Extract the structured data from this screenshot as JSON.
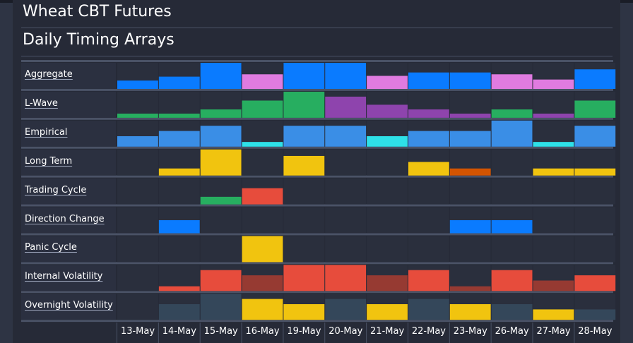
{
  "header": {
    "title": "Wheat CBT Futures",
    "subtitle": "Daily Timing Arrays"
  },
  "chart_data": {
    "type": "heatmap",
    "categories": [
      "13-May",
      "14-May",
      "15-May",
      "16-May",
      "19-May",
      "20-May",
      "21-May",
      "22-May",
      "23-May",
      "26-May",
      "27-May",
      "28-May"
    ],
    "value_range": [
      0,
      1
    ],
    "rows": [
      {
        "name": "Aggregate",
        "values": [
          0.32,
          0.47,
          1.0,
          0.56,
          1.0,
          1.0,
          0.5,
          0.63,
          0.63,
          0.56,
          0.36,
          0.75
        ],
        "colors": [
          "#0a7bff",
          "#0a7bff",
          "#0a7bff",
          "#e07be0",
          "#0a7bff",
          "#0a7bff",
          "#e07be0",
          "#0a7bff",
          "#0a7bff",
          "#e07be0",
          "#e07be0",
          "#0a7bff"
        ]
      },
      {
        "name": "L-Wave",
        "values": [
          0.16,
          0.16,
          0.32,
          0.66,
          1.0,
          0.81,
          0.5,
          0.32,
          0.16,
          0.32,
          0.16,
          0.66
        ],
        "colors": [
          "#27ae60",
          "#27ae60",
          "#27ae60",
          "#27ae60",
          "#27ae60",
          "#8e44ad",
          "#8e44ad",
          "#8e44ad",
          "#8e44ad",
          "#27ae60",
          "#8e44ad",
          "#27ae60"
        ]
      },
      {
        "name": "Empirical",
        "values": [
          0.4,
          0.6,
          0.8,
          0.18,
          0.8,
          0.8,
          0.4,
          0.6,
          0.6,
          1.0,
          0.18,
          0.8
        ],
        "colors": [
          "#3a8ee6",
          "#3a8ee6",
          "#3a8ee6",
          "#2ee0e8",
          "#3a8ee6",
          "#3a8ee6",
          "#2ee0e8",
          "#3a8ee6",
          "#3a8ee6",
          "#3a8ee6",
          "#2ee0e8",
          "#3a8ee6"
        ]
      },
      {
        "name": "Long Term",
        "values": [
          0,
          0.27,
          1.0,
          0,
          0.75,
          0,
          0,
          0.52,
          0.27,
          0,
          0.27,
          0.27
        ],
        "colors": [
          "#f1c40f",
          "#f1c40f",
          "#f1c40f",
          "#f1c40f",
          "#f1c40f",
          "#f1c40f",
          "#f1c40f",
          "#f1c40f",
          "#d35400",
          "#f1c40f",
          "#f1c40f",
          "#f1c40f"
        ]
      },
      {
        "name": "Trading Cycle",
        "values": [
          0,
          0,
          0.29,
          0.62,
          0,
          0,
          0,
          0,
          0,
          0,
          0,
          0
        ],
        "colors": [
          "#27ae60",
          "#27ae60",
          "#27ae60",
          "#e74c3c",
          "#27ae60",
          "#27ae60",
          "#27ae60",
          "#27ae60",
          "#27ae60",
          "#27ae60",
          "#27ae60",
          "#27ae60"
        ]
      },
      {
        "name": "Direction Change",
        "values": [
          0,
          0.5,
          0,
          0,
          0,
          0,
          0,
          0,
          0.5,
          0.5,
          0,
          0
        ],
        "colors": [
          "#0a7bff",
          "#0a7bff",
          "#0a7bff",
          "#0a7bff",
          "#0a7bff",
          "#0a7bff",
          "#0a7bff",
          "#0a7bff",
          "#0a7bff",
          "#0a7bff",
          "#0a7bff",
          "#0a7bff"
        ]
      },
      {
        "name": "Panic Cycle",
        "values": [
          0,
          0,
          0,
          1.0,
          0,
          0,
          0,
          0,
          0,
          0,
          0,
          0
        ],
        "colors": [
          "#f1c40f",
          "#f1c40f",
          "#f1c40f",
          "#f1c40f",
          "#f1c40f",
          "#f1c40f",
          "#f1c40f",
          "#f1c40f",
          "#f1c40f",
          "#f1c40f",
          "#f1c40f",
          "#f1c40f"
        ]
      },
      {
        "name": "Internal Volatility",
        "values": [
          0,
          0.18,
          0.8,
          0.6,
          1.0,
          1.0,
          0.6,
          0.8,
          0.18,
          0.8,
          0.4,
          0.6
        ],
        "colors": [
          "#e74c3c",
          "#e74c3c",
          "#e74c3c",
          "#963a32",
          "#e74c3c",
          "#e74c3c",
          "#963a32",
          "#e74c3c",
          "#963a32",
          "#e74c3c",
          "#963a32",
          "#e74c3c"
        ]
      },
      {
        "name": "Overnight Volatility",
        "values": [
          0,
          0.6,
          1.0,
          0.8,
          0.6,
          0.8,
          0.6,
          0.8,
          0.6,
          0.6,
          0.4,
          0.4
        ],
        "colors": [
          "#34475a",
          "#34475a",
          "#34475a",
          "#f1c40f",
          "#f1c40f",
          "#34475a",
          "#f1c40f",
          "#34475a",
          "#f1c40f",
          "#34475a",
          "#f1c40f",
          "#34475a"
        ]
      }
    ]
  }
}
